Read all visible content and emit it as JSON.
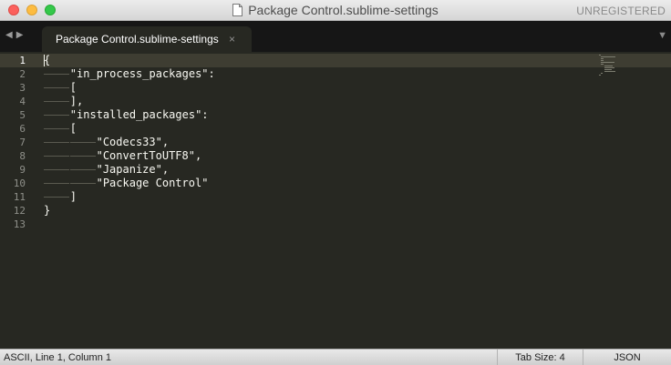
{
  "window": {
    "title": "Package Control.sublime-settings",
    "license_status": "UNREGISTERED"
  },
  "tabs": [
    {
      "label": "Package Control.sublime-settings",
      "active": true
    }
  ],
  "nav": {
    "back": "◀",
    "forward": "▶",
    "tab_list": "▼"
  },
  "editor": {
    "line_numbers": [
      "1",
      "2",
      "3",
      "4",
      "5",
      "6",
      "7",
      "8",
      "9",
      "10",
      "11",
      "12",
      "13"
    ],
    "active_line": 1,
    "lines": [
      "{",
      "\"in_process_packages\":",
      "[",
      "],",
      "\"installed_packages\":",
      "[",
      "\"Codecs33\",",
      "\"ConvertToUTF8\",",
      "\"Japanize\",",
      "\"Package Control\"",
      "]",
      "}",
      ""
    ],
    "indent_levels": [
      0,
      1,
      1,
      1,
      1,
      1,
      2,
      2,
      2,
      2,
      1,
      0,
      0
    ]
  },
  "statusbar": {
    "position": "ASCII, Line 1, Column 1",
    "tab_size": "Tab Size: 4",
    "syntax": "JSON"
  },
  "colors": {
    "editor_bg": "#272822",
    "foreground": "#f8f8f2",
    "gutter_fg": "#8f908a",
    "line_highlight": "#3e3d32",
    "tabbar_bg": "#161616"
  },
  "icons": {
    "document": "document-icon",
    "tab_close": "×"
  }
}
